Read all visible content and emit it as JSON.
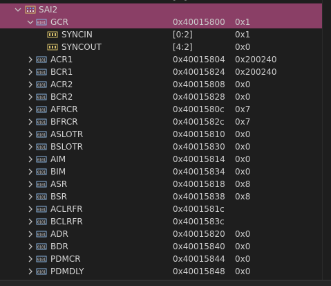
{
  "colors": {
    "background": "#1e1e1e",
    "selection": "#8a3f66",
    "text": "#cccccc"
  },
  "top_partial": {
    "value": "[...]"
  },
  "peripheral": {
    "name": "SAI2",
    "icon": "peripheral-icon"
  },
  "register_selected": {
    "name": "GCR",
    "address": "0x40015800",
    "value": "0x1"
  },
  "fields": [
    {
      "name": "SYNCIN",
      "address": "[0:2]",
      "value": "0x1"
    },
    {
      "name": "SYNCOUT",
      "address": "[4:2]",
      "value": "0x0"
    }
  ],
  "registers": [
    {
      "name": "ACR1",
      "address": "0x40015804",
      "value": "0x200240"
    },
    {
      "name": "BCR1",
      "address": "0x40015824",
      "value": "0x200240"
    },
    {
      "name": "ACR2",
      "address": "0x40015808",
      "value": "0x0"
    },
    {
      "name": "BCR2",
      "address": "0x40015828",
      "value": "0x0"
    },
    {
      "name": "AFRCR",
      "address": "0x4001580c",
      "value": "0x7"
    },
    {
      "name": "BFRCR",
      "address": "0x4001582c",
      "value": "0x7"
    },
    {
      "name": "ASLOTR",
      "address": "0x40015810",
      "value": "0x0"
    },
    {
      "name": "BSLOTR",
      "address": "0x40015830",
      "value": "0x0"
    },
    {
      "name": "AIM",
      "address": "0x40015814",
      "value": "0x0"
    },
    {
      "name": "BIM",
      "address": "0x40015834",
      "value": "0x0"
    },
    {
      "name": "ASR",
      "address": "0x40015818",
      "value": "0x8"
    },
    {
      "name": "BSR",
      "address": "0x40015838",
      "value": "0x8"
    },
    {
      "name": "ACLRFR",
      "address": "0x4001581c",
      "value": ""
    },
    {
      "name": "BCLRFR",
      "address": "0x4001583c",
      "value": ""
    },
    {
      "name": "ADR",
      "address": "0x40015820",
      "value": "0x0"
    },
    {
      "name": "BDR",
      "address": "0x40015840",
      "value": "0x0"
    },
    {
      "name": "PDMCR",
      "address": "0x40015844",
      "value": "0x0"
    },
    {
      "name": "PDMDLY",
      "address": "0x40015848",
      "value": "0x0"
    }
  ]
}
